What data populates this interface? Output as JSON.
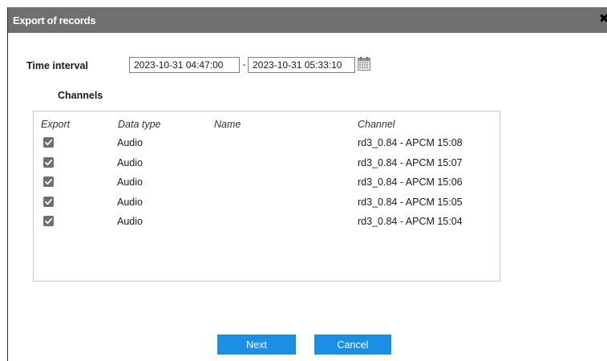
{
  "dialog": {
    "title": "Export of records",
    "close_glyph": "✖"
  },
  "time_interval": {
    "label": "Time interval",
    "from": "2023-10-31 04:47:00",
    "separator": "-",
    "to": "2023-10-31 05:33:10",
    "calendar_icon": "calendar-icon"
  },
  "channels": {
    "label": "Channels",
    "columns": {
      "export": "Export",
      "data_type": "Data type",
      "name": "Name",
      "channel": "Channel"
    },
    "rows": [
      {
        "checked": true,
        "data_type": "Audio",
        "name": "",
        "channel": "rd3_0.84 - APCM 15:08"
      },
      {
        "checked": true,
        "data_type": "Audio",
        "name": "",
        "channel": "rd3_0.84 - APCM 15:07"
      },
      {
        "checked": true,
        "data_type": "Audio",
        "name": "",
        "channel": "rd3_0.84 - APCM 15:06"
      },
      {
        "checked": true,
        "data_type": "Audio",
        "name": "",
        "channel": "rd3_0.84 - APCM 15:05"
      },
      {
        "checked": true,
        "data_type": "Audio",
        "name": "",
        "channel": "rd3_0.84 - APCM 15:04"
      }
    ]
  },
  "buttons": {
    "next": "Next",
    "cancel": "Cancel"
  },
  "colors": {
    "titlebar": "#707070",
    "button": "#1a8fe6",
    "checkbox": "#6f6f6f"
  }
}
